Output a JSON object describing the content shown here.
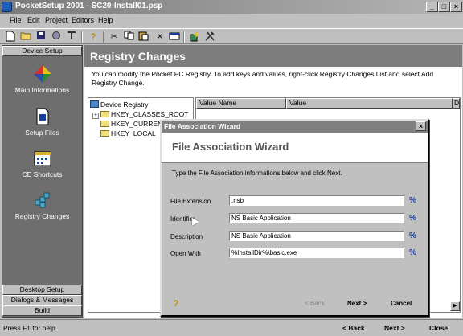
{
  "window": {
    "title": "PocketSetup 2001 - SC20-Install01.psp"
  },
  "menu": [
    "File",
    "Edit",
    "Project",
    "Editors",
    "Help"
  ],
  "toolbar": {
    "icons": [
      "new-file-icon",
      "open-folder-icon",
      "save-icon",
      "build-icon",
      "tools-icon",
      "help-icon",
      "cut-icon",
      "copy-icon",
      "paste-icon",
      "delete-icon",
      "properties-icon",
      "wizard-icon",
      "settings-icon"
    ]
  },
  "sidebar": {
    "top_header": "Device Setup",
    "items": [
      {
        "label": "Main Informations",
        "icon": "diamond-icon"
      },
      {
        "label": "Setup Files",
        "icon": "file-icon"
      },
      {
        "label": "CE Shortcuts",
        "icon": "shortcut-icon"
      },
      {
        "label": "Registry Changes",
        "icon": "registry-icon"
      }
    ],
    "bottom_headers": [
      "Desktop Setup",
      "Dialogs & Messages",
      "Build"
    ]
  },
  "main": {
    "title": "Registry Changes",
    "description": "You can modify the Pocket PC Registry. To add keys and values, right-click Registry Changes List and select Add Registry Change.",
    "tree": {
      "root": "Device Registry",
      "keys": [
        "HKEY_CLASSES_ROOT",
        "HKEY_CURRENT_",
        "HKEY_LOCAL_M"
      ]
    },
    "columns": [
      "Value Name",
      "Value",
      "D"
    ]
  },
  "dialog": {
    "title": "File Association Wizard",
    "header": "File Association Wizard",
    "intro": "Type the File Association informations below and click Next.",
    "fields": [
      {
        "label": "File Extension",
        "value": ".nsb"
      },
      {
        "label": "Identifier",
        "value": "NS Basic Application"
      },
      {
        "label": "Description",
        "value": "NS Basic Application"
      },
      {
        "label": "Open With",
        "value": "%InstallDir%\\basic.exe"
      }
    ],
    "pct_symbol": "%",
    "buttons": {
      "back": "< Back",
      "next": "Next >",
      "cancel": "Cancel"
    }
  },
  "status": {
    "text": "Press F1 for help",
    "back": "< Back",
    "next": "Next >",
    "close": "Close"
  }
}
